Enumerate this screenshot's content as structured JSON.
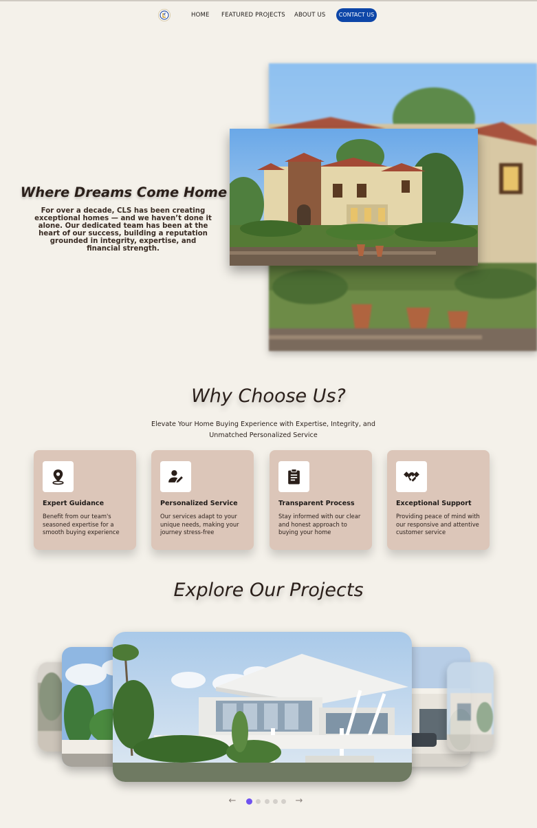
{
  "nav": {
    "logo_label": "CLS",
    "links": [
      "HOME",
      "FEATURED PROJECTS",
      "ABOUT US"
    ],
    "cta": "CONTACT US"
  },
  "hero": {
    "title": "Where Dreams Come Home",
    "text": "For over a decade, CLS has been creating exceptional homes — and we haven’t done it alone. Our dedicated team has been at the heart of our success, building a reputation grounded in integrity, expertise, and financial strength."
  },
  "why": {
    "title": "Why Choose Us?",
    "subtitle": "Elevate Your Home Buying Experience with Expertise, Integrity, and Unmatched Personalized Service",
    "cards": [
      {
        "icon": "location-pin-icon",
        "title": "Expert Guidance",
        "desc": "Benefit from our team's seasoned expertise for a smooth buying experience"
      },
      {
        "icon": "person-edit-icon",
        "title": "Personalized Service",
        "desc": "Our services adapt to your unique needs, making your journey stress-free"
      },
      {
        "icon": "clipboard-icon",
        "title": "Transparent Process",
        "desc": "Stay informed with our clear and honest approach to buying your home"
      },
      {
        "icon": "handshake-icon",
        "title": "Exceptional Support",
        "desc": "Providing peace of mind with our responsive and attentive customer service"
      }
    ]
  },
  "projects": {
    "title": "Explore Our Projects",
    "slide_count": 5,
    "active_slide": 1,
    "prev_icon": "arrow-left-icon",
    "next_icon": "arrow-right-icon"
  },
  "colors": {
    "background": "#f4f1ea",
    "card": "#dcc6b9",
    "cta": "#0d46a8",
    "active_dot": "#6f52f0"
  }
}
